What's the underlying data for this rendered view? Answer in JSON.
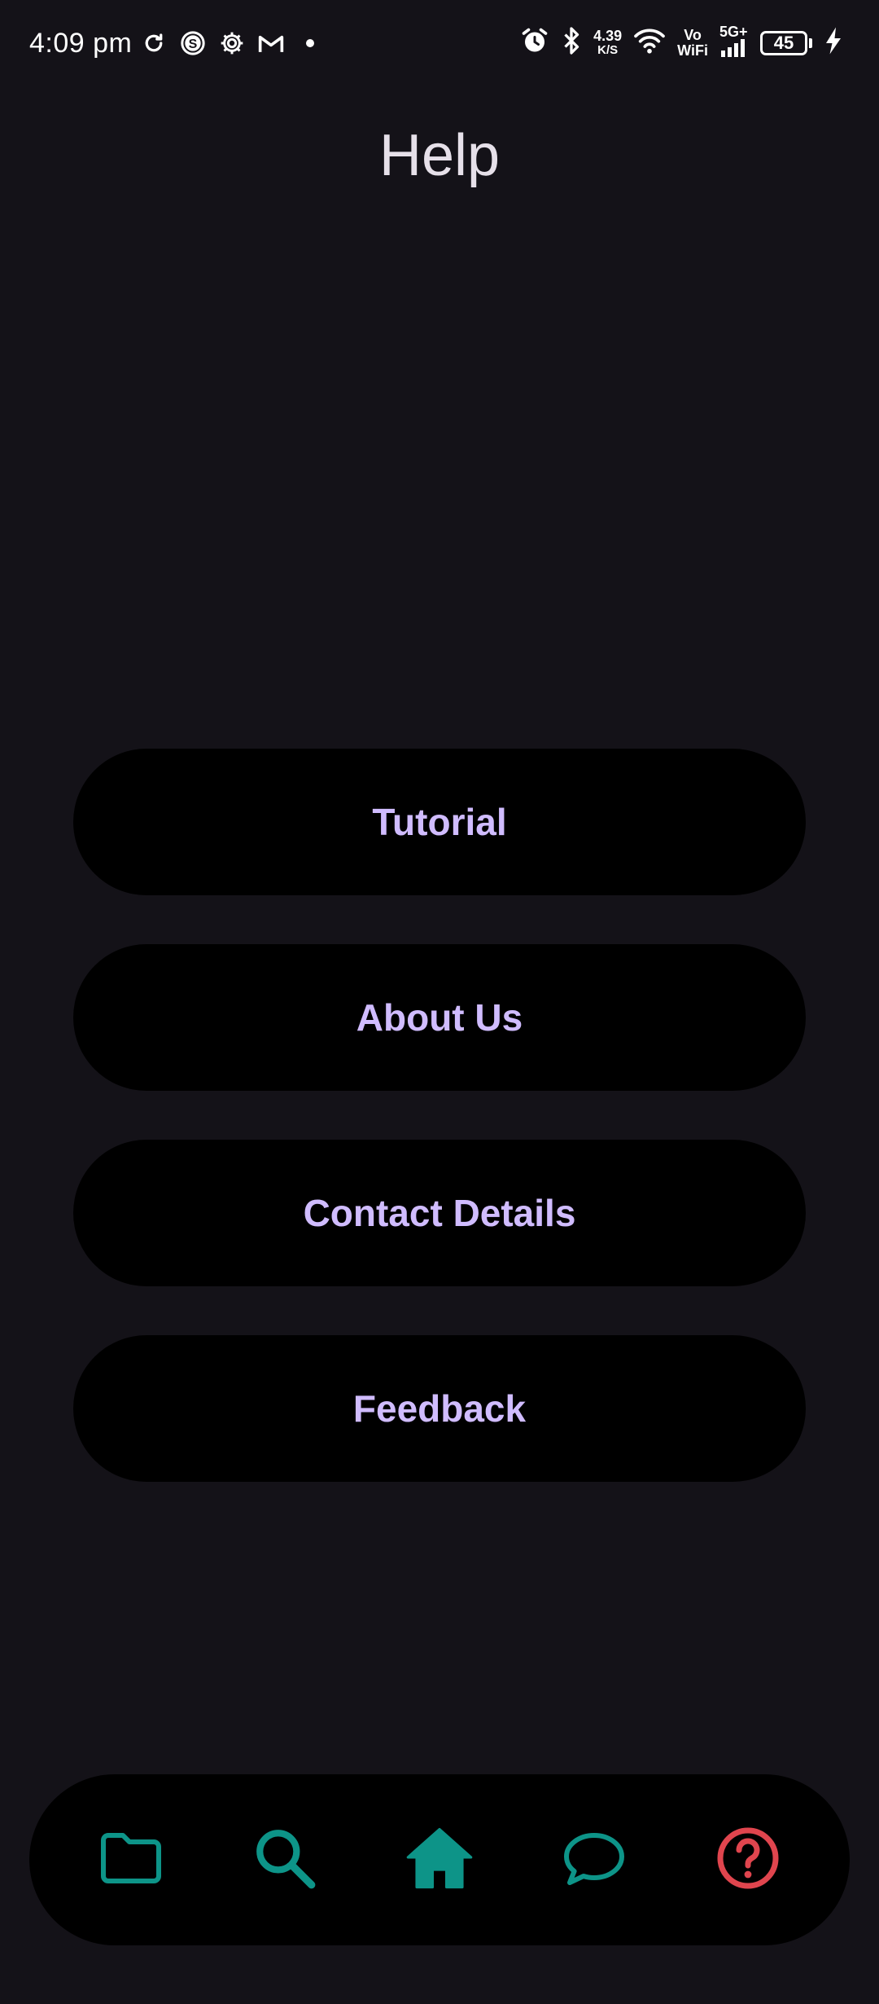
{
  "status_bar": {
    "time": "4:09 pm",
    "net_speed_value": "4.39",
    "net_speed_unit": "K/S",
    "vo_label": "Vo",
    "wifi_label": "WiFi",
    "network_type": "5G+",
    "battery_level": "45",
    "left_icons": [
      "sync-icon",
      "s-app-icon",
      "settings-gear-icon",
      "gmail-icon",
      "dot-icon"
    ],
    "right_icons": [
      "alarm-icon",
      "bluetooth-icon",
      "wifi-icon",
      "signal-icon",
      "charging-bolt-icon"
    ]
  },
  "page": {
    "title": "Help"
  },
  "menu": {
    "items": [
      {
        "label": "Tutorial"
      },
      {
        "label": "About Us"
      },
      {
        "label": "Contact Details"
      },
      {
        "label": "Feedback"
      }
    ],
    "button_bg": "#000000",
    "label_color": "#d0bcff"
  },
  "bottom_nav": {
    "items": [
      {
        "icon": "folder-icon",
        "color": "#0d9488"
      },
      {
        "icon": "search-icon",
        "color": "#0d9488"
      },
      {
        "icon": "home-icon",
        "color": "#0d9488"
      },
      {
        "icon": "chat-icon",
        "color": "#0d9488"
      },
      {
        "icon": "help-icon",
        "color": "#e0454e",
        "active": true
      }
    ]
  },
  "colors": {
    "background": "#141218",
    "title_text": "#e6e0e9",
    "accent_teal": "#0d9488",
    "accent_red": "#e0454e"
  }
}
